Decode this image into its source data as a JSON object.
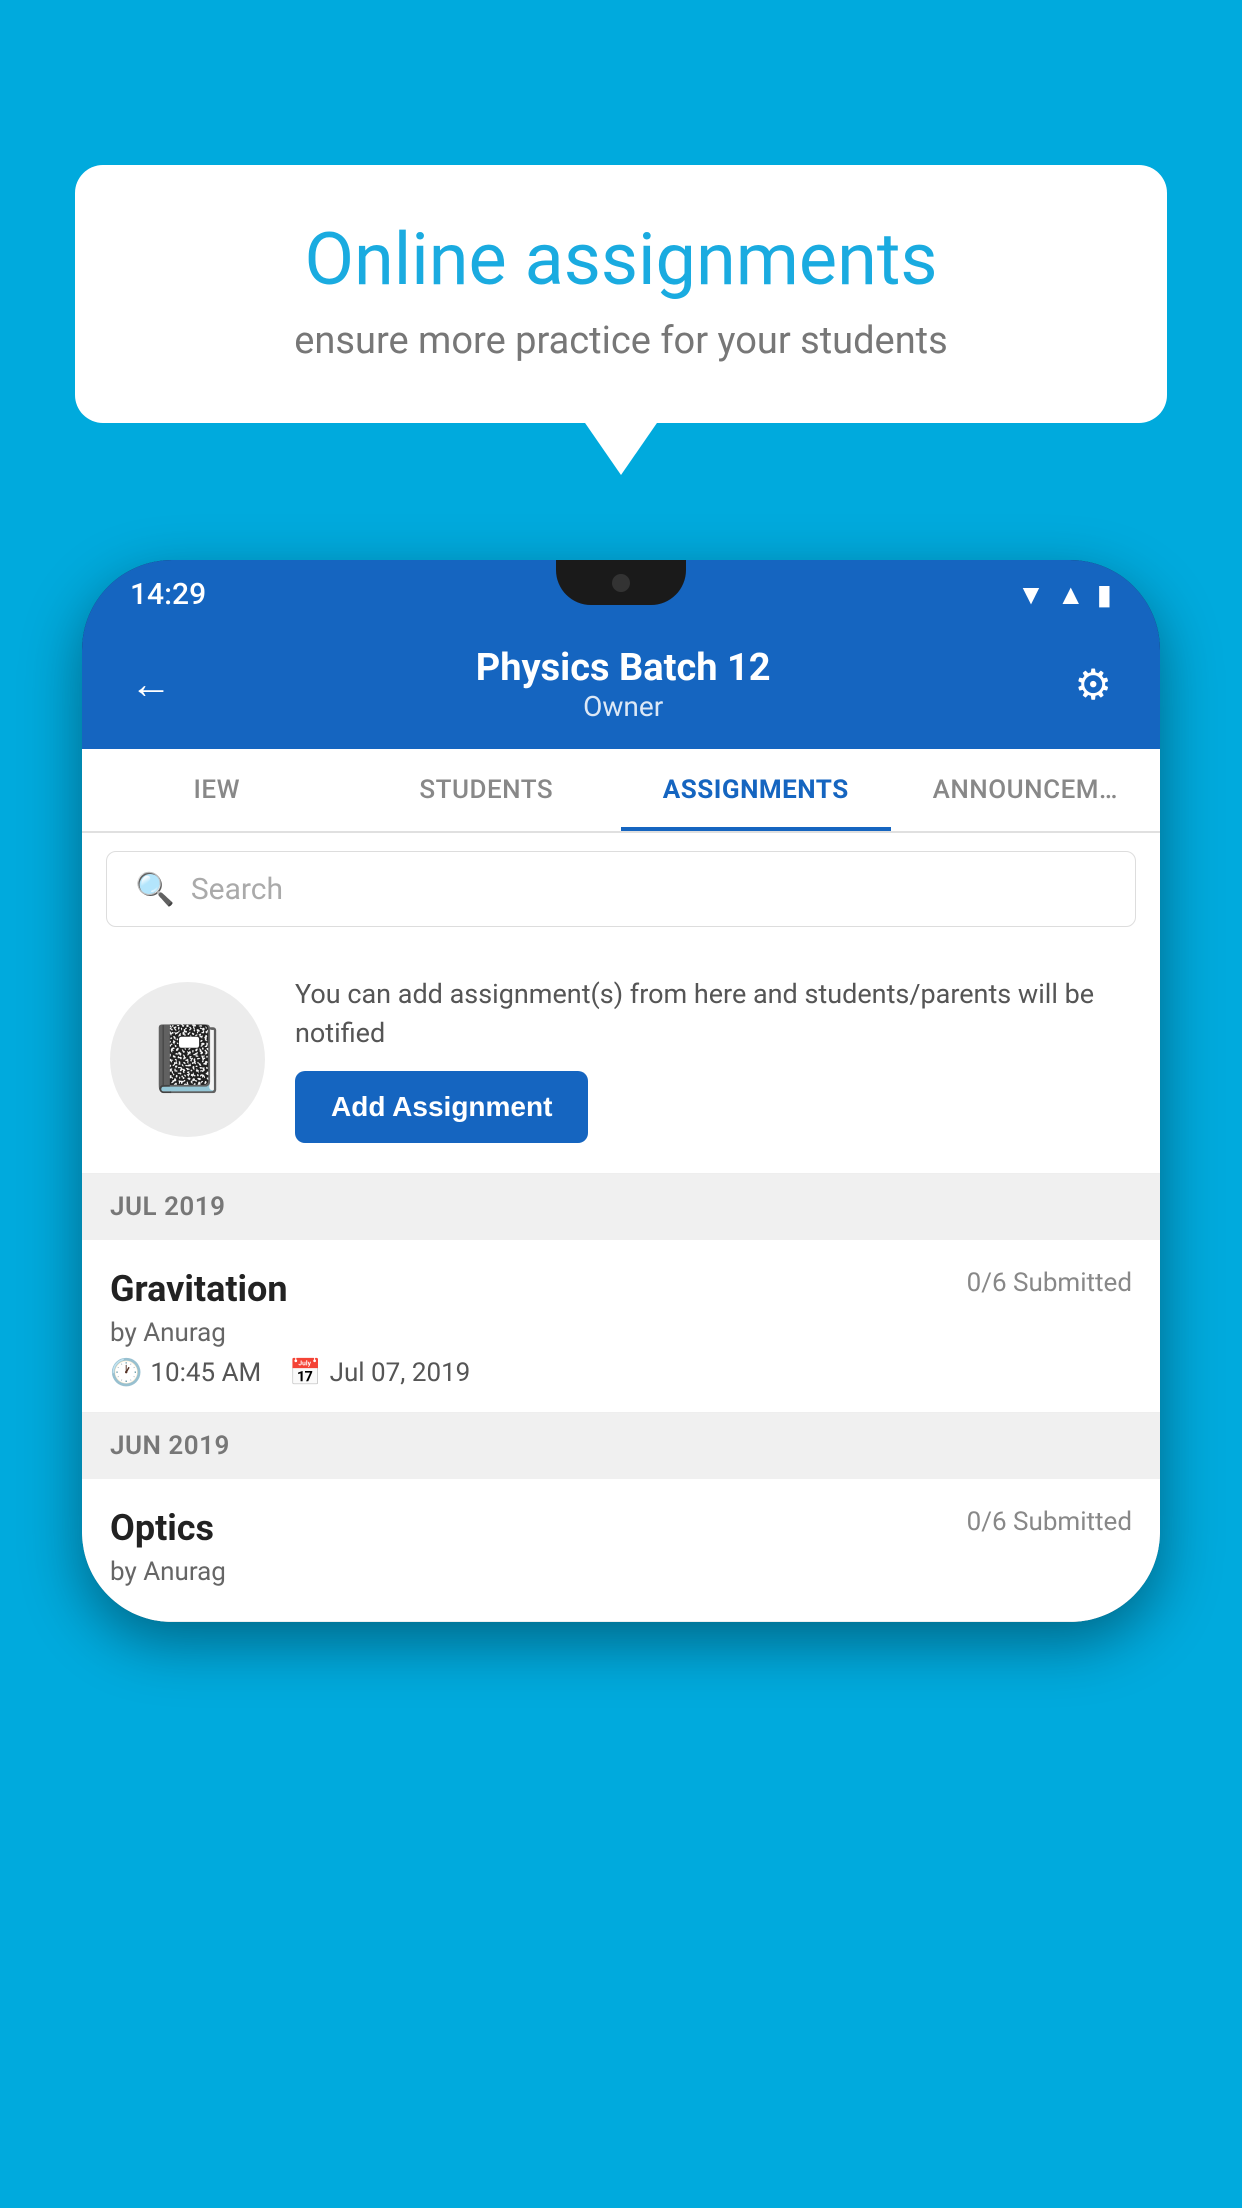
{
  "background_color": "#00AADD",
  "speech_bubble": {
    "title": "Online assignments",
    "subtitle": "ensure more practice for your students"
  },
  "phone": {
    "status_bar": {
      "time": "14:29",
      "icons": [
        "wifi",
        "signal",
        "battery"
      ]
    },
    "header": {
      "back_label": "←",
      "title": "Physics Batch 12",
      "subtitle": "Owner",
      "settings_label": "⚙"
    },
    "tabs": [
      {
        "label": "IEW",
        "active": false
      },
      {
        "label": "STUDENTS",
        "active": false
      },
      {
        "label": "ASSIGNMENTS",
        "active": true
      },
      {
        "label": "ANNOUNCEM…",
        "active": false
      }
    ],
    "search": {
      "placeholder": "Search"
    },
    "promo": {
      "description": "You can add assignment(s) from here and students/parents will be notified",
      "button_label": "Add Assignment"
    },
    "sections": [
      {
        "month": "JUL 2019",
        "assignments": [
          {
            "name": "Gravitation",
            "submitted": "0/6 Submitted",
            "by": "by Anurag",
            "time": "10:45 AM",
            "date": "Jul 07, 2019"
          }
        ]
      },
      {
        "month": "JUN 2019",
        "assignments": [
          {
            "name": "Optics",
            "submitted": "0/6 Submitted",
            "by": "by Anurag",
            "time": "",
            "date": ""
          }
        ]
      }
    ]
  }
}
